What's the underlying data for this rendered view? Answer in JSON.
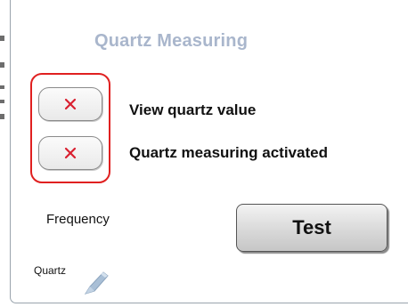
{
  "panel": {
    "title": "Quartz Measuring"
  },
  "options": [
    {
      "label": "View quartz value",
      "checked": false,
      "icon": "x-icon"
    },
    {
      "label": "Quartz measuring activated",
      "checked": false,
      "icon": "x-icon"
    }
  ],
  "frequency": {
    "label": "Frequency"
  },
  "test_button": {
    "label": "Test"
  },
  "quartz": {
    "label": "Quartz",
    "icon": "crystal-icon"
  },
  "colors": {
    "title": "#a9b6cc",
    "highlight_frame": "#e02020",
    "x_mark": "#d92030"
  }
}
